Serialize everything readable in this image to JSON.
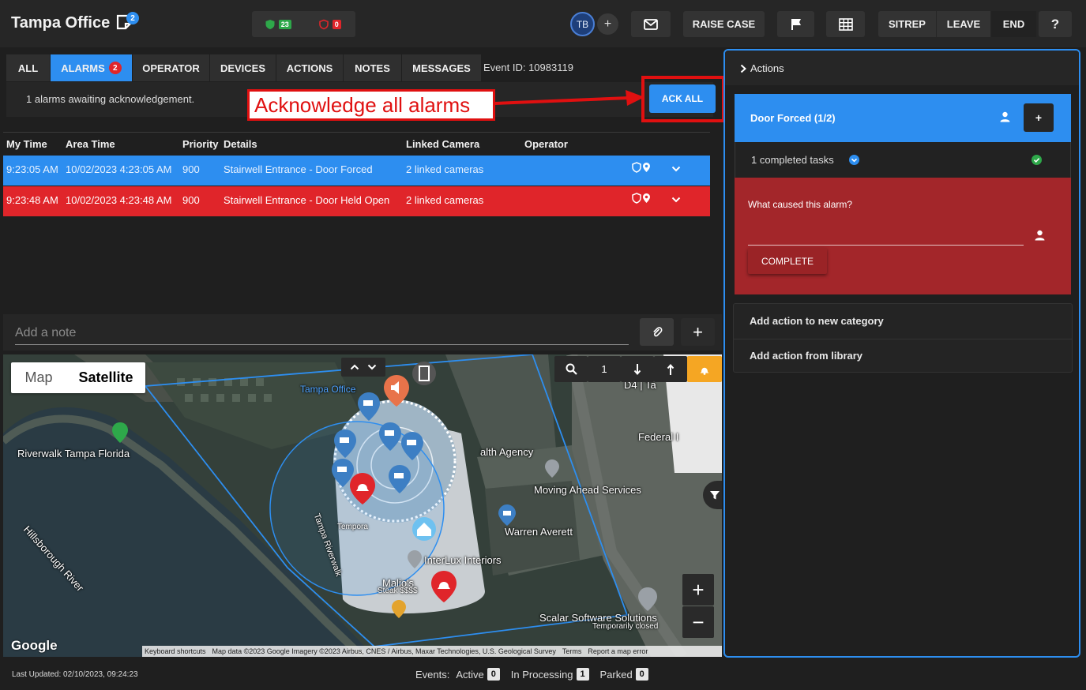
{
  "header": {
    "title": "Tampa Office",
    "notes_badge": "2",
    "secure_count": "23",
    "alarm_count": "0",
    "user_initials": "TB",
    "add_user": "+",
    "raise_case": "RAISE CASE",
    "sitrep": "SITREP",
    "leave": "LEAVE",
    "end": "END",
    "help": "?"
  },
  "tabs": [
    {
      "label": "ALL"
    },
    {
      "label": "ALARMS",
      "badge": "2"
    },
    {
      "label": "OPERATOR"
    },
    {
      "label": "DEVICES"
    },
    {
      "label": "ACTIONS"
    },
    {
      "label": "NOTES"
    },
    {
      "label": "MESSAGES"
    }
  ],
  "event_id": "Event ID: 10983119",
  "ack": {
    "text": "1 alarms awaiting acknowledgement.",
    "button": "ACK ALL",
    "callout": "Acknowledge all alarms"
  },
  "table": {
    "columns": [
      "My Time",
      "Area Time",
      "Priority",
      "Details",
      "Linked Camera",
      "Operator"
    ],
    "rows": [
      {
        "my_time": "9:23:05 AM",
        "area_time": "10/02/2023 4:23:05 AM",
        "priority": "900",
        "details": "Stairwell Entrance - Door Forced",
        "camera": "2 linked cameras",
        "operator": "",
        "color": "#2d8ef0"
      },
      {
        "my_time": "9:23:48 AM",
        "area_time": "10/02/2023 4:23:48 AM",
        "priority": "900",
        "details": "Stairwell Entrance - Door Held Open",
        "camera": "2 linked cameras",
        "operator": "",
        "color": "#e0252a"
      }
    ]
  },
  "note": {
    "placeholder": "Add a note",
    "add": "+"
  },
  "map": {
    "type_map": "Map",
    "type_satellite": "Satellite",
    "zoom_value": "1",
    "zoom_in": "+",
    "zoom_out": "−",
    "labels": {
      "tampa_office": "Tampa Office",
      "riverwalk": "Riverwalk Tampa Florida",
      "river": "Hillsborough River",
      "health_agency": "alth Agency",
      "federal": "Federal I",
      "moving_ahead": "Moving Ahead Services",
      "warren": "Warren Averett",
      "interlux": "InterLux Interiors",
      "malios": "Malio's",
      "malios_sub": "Steak $$$$",
      "scalar": "Scalar Software Solutions",
      "scalar_sub": "Temporarily closed",
      "tampa_riverwalk": "Tampa Riverwalk",
      "tempora": "Tempora",
      "d4": "D4 | Ta",
      "google": "Google"
    },
    "attribution": {
      "shortcuts": "Keyboard shortcuts",
      "data": "Map data ©2023 Google Imagery ©2023 Airbus, CNES / Airbus, Maxar Technologies, U.S. Geological Survey",
      "terms": "Terms",
      "report": "Report a map error"
    }
  },
  "panel": {
    "header": "Actions",
    "category": "Door Forced (1/2)",
    "category_add": "+",
    "completed": "1 completed tasks",
    "question": "What caused this alarm?",
    "complete_button": "COMPLETE",
    "add_category": "Add action to new category",
    "add_library": "Add action from library"
  },
  "footer": {
    "last_updated": "Last Updated: 02/10/2023, 09:24:23",
    "events_label": "Events:",
    "active_label": "Active",
    "active": "0",
    "processing_label": "In Processing",
    "processing": "1",
    "parked_label": "Parked",
    "parked": "0"
  },
  "colors": {
    "accent": "#2d8ef0",
    "alarm": "#e0252a",
    "task": "#a3262a",
    "success": "#2ea84a"
  }
}
